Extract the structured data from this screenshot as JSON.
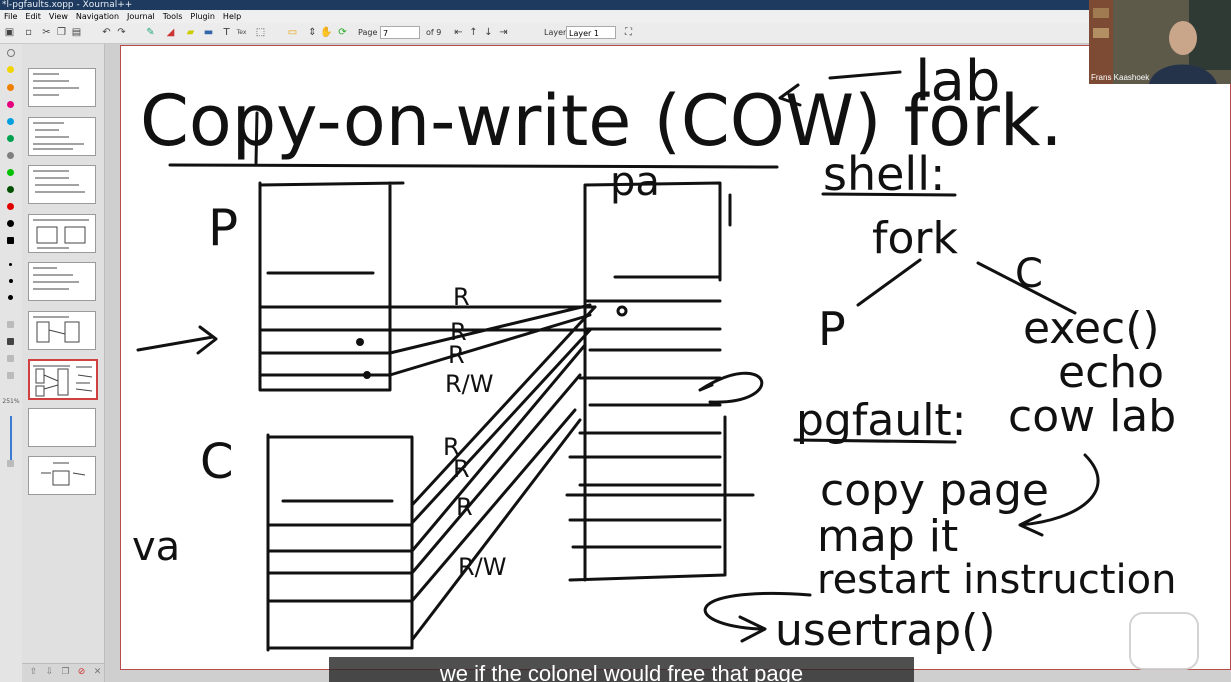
{
  "window": {
    "title": "*l-pgfaults.xopp - Xournal++"
  },
  "menu": [
    "File",
    "Edit",
    "View",
    "Navigation",
    "Journal",
    "Tools",
    "Plugin",
    "Help"
  ],
  "toolbar": {
    "page_label": "Page",
    "page_value": "7",
    "page_total": "of 9",
    "layer_label": "Layer",
    "layer_value": "Layer 1",
    "zoom": "251%"
  },
  "colors": [
    "#ffffff",
    "#f2d400",
    "#ee7f00",
    "#e6007e",
    "#00a0e0",
    "#00a050",
    "#808080",
    "#00c000",
    "#005000",
    "#e00000",
    "#000080",
    "#000000"
  ],
  "video": {
    "name": "Frans Kaashoek"
  },
  "subtitle": "we if the colonel would free that page",
  "note": {
    "title": "Copy-on-write (COW) fork.",
    "lab": "lab",
    "label_p": "P",
    "label_c": "C",
    "label_va": "va",
    "label_pa": "pa",
    "pte_flags": [
      "R",
      "R",
      "R",
      "R/W",
      "R",
      "R",
      "R",
      "R/W"
    ],
    "shell": "shell:",
    "fork": "fork",
    "child_c": "C",
    "parent_p": "P",
    "exec": "exec()",
    "echo": "echo",
    "cow_lab": "cow lab",
    "pgfault": "pgfault:",
    "steps": [
      "copy page",
      "map it",
      "restart instruction"
    ],
    "usertrap": "usertrap()"
  }
}
